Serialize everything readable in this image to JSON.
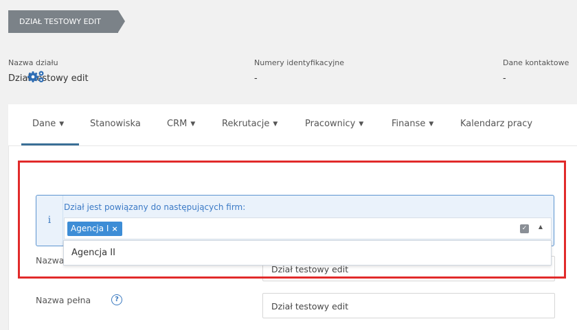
{
  "breadcrumb": {
    "label": "DZIAŁ TESTOWY EDIT"
  },
  "info": {
    "name_label": "Nazwa działu",
    "name_value": "Dział testowy edit",
    "ids_label": "Numery identyfikacyjne",
    "ids_value": "-",
    "contact_label": "Dane kontaktowe",
    "contact_value": "-"
  },
  "tabs": [
    {
      "label": "Dane",
      "dropdown": true,
      "active": true
    },
    {
      "label": "Stanowiska",
      "dropdown": false
    },
    {
      "label": "CRM",
      "dropdown": true
    },
    {
      "label": "Rekrutacje",
      "dropdown": true
    },
    {
      "label": "Pracownicy",
      "dropdown": true
    },
    {
      "label": "Finanse",
      "dropdown": true
    },
    {
      "label": "Kalendarz pracy",
      "dropdown": false
    }
  ],
  "icons": {
    "settings": "gears-icon",
    "info": "info-icon",
    "help": "question-circle-icon"
  },
  "alert": {
    "icon_glyph": "i",
    "message": "Dział jest powiązany do następujących firm:",
    "selected_tag": "Agencja I",
    "tag_remove": "×",
    "dropdown_option": "Agencja II"
  },
  "form": {
    "short_name_label": "Nazwa",
    "short_name_value": "Dział testowy edit",
    "full_name_label": "Nazwa pełna",
    "full_name_value": "Dział testowy edit",
    "help_glyph": "?"
  },
  "colors": {
    "accent": "#3a6f96",
    "highlight": "#e12a2a",
    "tag": "#3d8dd6"
  }
}
